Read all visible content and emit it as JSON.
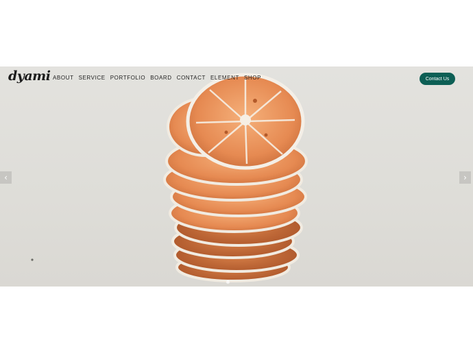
{
  "brand": {
    "logo": "dyami"
  },
  "nav": {
    "items": [
      "About",
      "Service",
      "Portfolio",
      "Board",
      "Contact",
      "Element",
      "Shop"
    ],
    "cta_label": "Contact Us"
  },
  "slider": {
    "prev_icon": "chevron-left-icon",
    "next_icon": "chevron-right-icon",
    "image": "stack of dried orange slices"
  },
  "colors": {
    "accent": "#0d5f55",
    "hero_bg": "#e0dfdb",
    "orange": "#e3884f",
    "orange_dark": "#c8693a",
    "rind": "#f3eee6"
  }
}
